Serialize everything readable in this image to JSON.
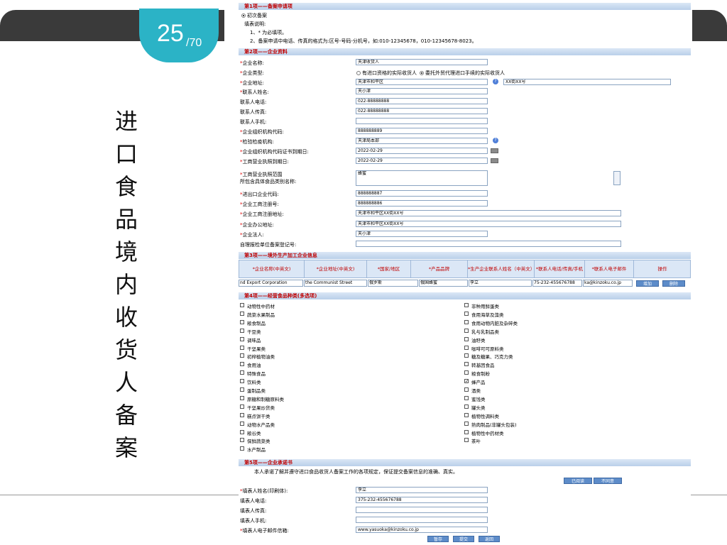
{
  "slide": {
    "page_number": "25",
    "page_total": "/70",
    "vertical_title": [
      "进",
      "口",
      "食",
      "品",
      "境",
      "内",
      "收",
      "货",
      "人",
      "备",
      "案"
    ]
  },
  "form": {
    "sec1": {
      "title": "第1项——备案申请项",
      "radio_label": "初次备案",
      "notes_title": "填表说明:",
      "note1": "1、* 为必填项。",
      "note2": "2、备案申请中电话、传真的格式为:区号-号码-分机号，如:010-12345678，010-12345678-8023。"
    },
    "sec2": {
      "title": "第2项——企业资料",
      "rows": [
        {
          "req": true,
          "label": "企业名称:",
          "value": "天津收货人"
        },
        {
          "req": true,
          "label": "企业类型:",
          "option1": "有进口资格的实际收货人",
          "option2": "委托外贸代理进口手续的实际收货人"
        },
        {
          "req": true,
          "label": "企业地址:",
          "value": "天津市和平区",
          "value2": "XX街XX号"
        },
        {
          "req": true,
          "label": "联系人姓名:",
          "value": "天小津"
        },
        {
          "req": false,
          "label": "联系人电话:",
          "value": "022-88888888"
        },
        {
          "req": false,
          "label": "联系人传真:",
          "value": "022-88888888"
        },
        {
          "req": false,
          "label": "联系人手机:",
          "value": ""
        },
        {
          "req": true,
          "label": "企业组织机构代码:",
          "value": "888888889"
        },
        {
          "req": true,
          "label": "检验检疫机构:",
          "value": "天津局本部"
        },
        {
          "req": true,
          "label": "企业组织机构代码证书到期日:",
          "value": "2022-02-29"
        },
        {
          "req": true,
          "label": "工商营业执照到期日:",
          "value": "2022-02-29"
        },
        {
          "req": true,
          "label": "工商营业执照范围",
          "label2": "所包含具体食品类别名称:",
          "value": "蜂蜜"
        },
        {
          "req": true,
          "label": "进出口企业代码:",
          "value": "888888887"
        },
        {
          "req": true,
          "label": "企业工商注册号:",
          "value": "888888886"
        },
        {
          "req": true,
          "label": "企业工商注册地址:",
          "value": "天津市和平区XX街XX号"
        },
        {
          "req": true,
          "label": "企业办公地址:",
          "value": "天津市和平区XX街XX号"
        },
        {
          "req": true,
          "label": "企业法人:",
          "value": "天小津"
        },
        {
          "req": false,
          "label": "自理报检单位备案登记号:",
          "value": ""
        }
      ]
    },
    "sec3": {
      "title": "第3项——境外生产加工企业信息",
      "headers": [
        "*企业名称(中英文)",
        "*企业地址(中英文)",
        "*国家/地区",
        "*产品品牌",
        "*生产企业联系人姓名（中英文）",
        "*联系人电话/传真/手机",
        "*联系人电子邮件",
        "操作"
      ],
      "row": [
        "nd Export Corporation",
        "the Communist Street",
        "俄罗斯",
        "俄国蜂蜜",
        "李立",
        "75-232-455676788",
        "ka@kinzoku.co.jp"
      ],
      "add_label": "增加",
      "delete_label": "删除"
    },
    "sec4": {
      "title": "第4项——经营食品种类(多选项)",
      "left": [
        "动物性中药材",
        "蔬菜水果制品",
        "粮食制品",
        "干豆类",
        "调味品",
        "干坚果类",
        "初榨植物油类",
        "食用油",
        "特殊食品",
        "饮料类",
        "蛋制品类",
        "原糖和制糖原料类",
        "干坚果炒货类",
        "糕点饼干类",
        "动物水产品类",
        "粮谷类",
        "保鲜蔬菜类",
        "水产制品"
      ],
      "right": [
        "非种用鲜蛋类",
        "食用海草及藻类",
        "食用动物内脏及杂碎类",
        "乳与乳制品类",
        "油籽类",
        "咖啡可可原料类",
        "糖及糖果、巧克力类",
        "转基因食品",
        "粮食制粉",
        "蜂产品",
        "酒类",
        "蜜饯类",
        "罐头类",
        "植物性调料类",
        "熟肉制品(非罐头包装)",
        "植物性中药材类",
        "茶叶"
      ],
      "checked_right_index": 9
    },
    "sec5": {
      "title": "第5项——企业承诺书",
      "promise": "本人承诺了解并遵守进口食品收货人备案工作的各项规定，保证提交备案信息的准确、真实。",
      "read_label": "已阅读",
      "disagree_label": "不同意",
      "rows": [
        {
          "req": true,
          "label": "填表人姓名(印刷体):",
          "value": "李立"
        },
        {
          "req": false,
          "label": "填表人电话:",
          "value": "375-232-455676788"
        },
        {
          "req": false,
          "label": "填表人传真:",
          "value": ""
        },
        {
          "req": false,
          "label": "填表人手机:",
          "value": ""
        },
        {
          "req": true,
          "label": "填表人电子邮件信箱:",
          "value": "www.yasuoka@kinzoku.co.jp"
        }
      ],
      "save_label": "暂存",
      "submit_label": "提交",
      "back_label": "返回"
    }
  },
  "colors": {
    "band": "#3a3a3a",
    "badge": "#2bb3c6",
    "section_title": "#c00000",
    "required": "#e00000",
    "button": "#5d8cc9"
  }
}
